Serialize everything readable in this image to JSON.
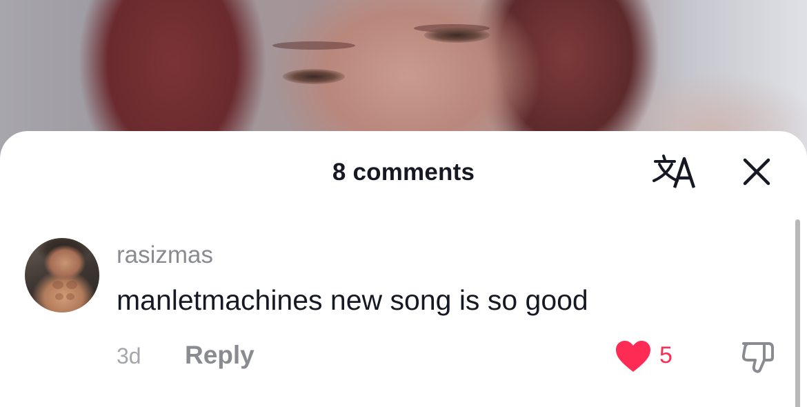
{
  "sheet": {
    "title": "8 comments",
    "translate_icon": "translate-icon",
    "close_icon": "close-icon"
  },
  "comments": [
    {
      "avatar": "user-avatar",
      "username": "rasizmas",
      "text": "manletmachines new song is so good",
      "time": "3d",
      "reply_label": "Reply",
      "like_icon": "heart-icon",
      "likes": "5",
      "dislike_icon": "thumbs-down-icon"
    }
  ],
  "colors": {
    "text_primary": "#161823",
    "text_secondary": "#8a8b91",
    "like_red": "#fe2c55"
  }
}
